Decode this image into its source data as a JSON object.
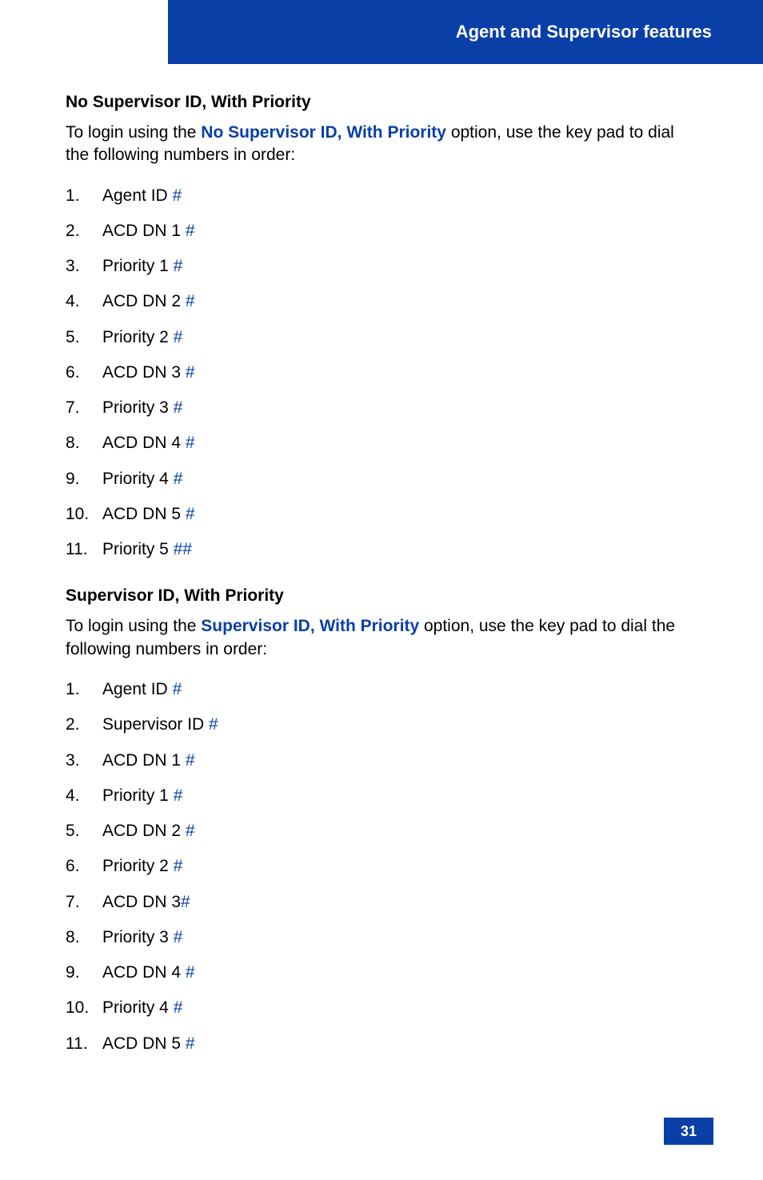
{
  "header": {
    "title": "Agent and Supervisor features"
  },
  "section1": {
    "heading": "No Supervisor ID, With Priority",
    "intro_pre": "To login using the ",
    "intro_bold": "No Supervisor ID, With Priority",
    "intro_post": " option, use the key pad to dial the following numbers in order:",
    "items": [
      {
        "text": "Agent ID ",
        "hash": "#"
      },
      {
        "text": "ACD DN 1 ",
        "hash": "#"
      },
      {
        "text": "Priority 1 ",
        "hash": "#"
      },
      {
        "text": "ACD DN 2 ",
        "hash": "#"
      },
      {
        "text": "Priority 2 ",
        "hash": "#"
      },
      {
        "text": "ACD DN 3 ",
        "hash": "#"
      },
      {
        "text": "Priority 3 ",
        "hash": "#"
      },
      {
        "text": "ACD DN 4 ",
        "hash": "#"
      },
      {
        "text": "Priority 4 ",
        "hash": "#"
      },
      {
        "text": "ACD DN 5 ",
        "hash": "#"
      },
      {
        "text": "Priority 5 ",
        "hash": "##"
      }
    ]
  },
  "section2": {
    "heading": "Supervisor ID, With Priority",
    "intro_pre": "To login using the ",
    "intro_bold": "Supervisor ID, With Priority",
    "intro_post": " option, use the key pad to dial the following numbers in order:",
    "items": [
      {
        "text": "Agent ID ",
        "hash": "#"
      },
      {
        "text": "Supervisor ID ",
        "hash": "#"
      },
      {
        "text": "ACD DN 1 ",
        "hash": "#"
      },
      {
        "text": "Priority 1 ",
        "hash": "#"
      },
      {
        "text": "ACD DN 2 ",
        "hash": "#"
      },
      {
        "text": "Priority 2 ",
        "hash": "#"
      },
      {
        "text": "ACD DN 3",
        "hash": "#"
      },
      {
        "text": "Priority 3 ",
        "hash": "#"
      },
      {
        "text": "ACD DN 4 ",
        "hash": "#"
      },
      {
        "text": "Priority 4 ",
        "hash": "#"
      },
      {
        "text": "ACD DN 5 ",
        "hash": "#"
      }
    ]
  },
  "page_number": "31"
}
